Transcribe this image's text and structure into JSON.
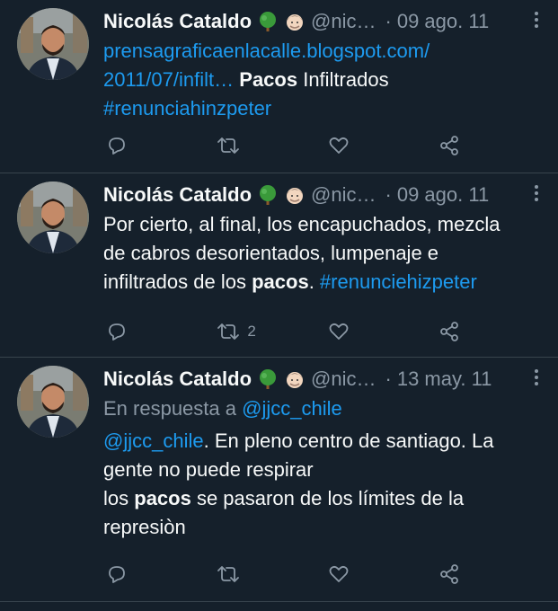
{
  "colors": {
    "background": "#15202b",
    "link": "#1d9bf0",
    "muted": "#8b98a5",
    "divider": "#38444d"
  },
  "tweets": [
    {
      "name": "Nicolás Cataldo",
      "emojis": [
        "tree-emoji",
        "man-face-emoji"
      ],
      "handle": "@nic…",
      "dot": "·",
      "date": "09 ago. 11",
      "link_line1": "prensagraficaenlacalle.blogspot.com/",
      "link_line2": "2011/07/infilt…",
      "bold_word": "Pacos",
      "after_bold": " Infiltrados",
      "hashtag": "#renunciahinzpeter",
      "retweet_count": ""
    },
    {
      "name": "Nicolás Cataldo",
      "emojis": [
        "tree-emoji",
        "man-face-emoji"
      ],
      "handle": "@nic…",
      "dot": "·",
      "date": "09 ago. 11",
      "line1": "Por cierto, al final, los encapuchados, mezcla",
      "line2": "de cabros desorientados, lumpenaje e",
      "line3_before": "infiltrados de los ",
      "bold_word": "pacos",
      "line3_after": ". ",
      "hashtag": "#renunciehizpeter",
      "retweet_count": "2"
    },
    {
      "name": "Nicolás Cataldo",
      "emojis": [
        "tree-emoji",
        "man-face-emoji"
      ],
      "handle": "@nic…",
      "dot": "·",
      "date": "13 may. 11",
      "reply_prefix": "En respuesta a ",
      "reply_to": "@jjcc_chile",
      "mention": "@jjcc_chile",
      "line1_after": ". En pleno centro de santiago. La",
      "line2": "gente no puede respirar",
      "line3_before": "los ",
      "bold_word": "pacos",
      "line3_after": " se pasaron de los límites de la",
      "line4": "represiòn",
      "retweet_count": ""
    }
  ]
}
